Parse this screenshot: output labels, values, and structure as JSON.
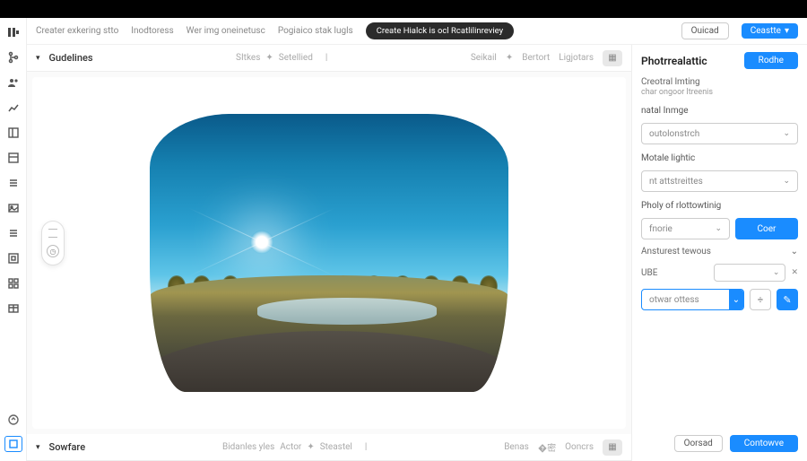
{
  "topbar": {
    "tabs": [
      "Creater exkering stto",
      "Inodtoress",
      "Wer img oneinetusc",
      "Pogiaico stak lugls"
    ],
    "pill": "Create Hialck is ocl Rcatlilinreviey",
    "outline_btn": "Ouicad",
    "primary_btn": "Ceastte"
  },
  "section_guidelines": {
    "title": "Gudelines",
    "mid": [
      "SItkes",
      "Setellied"
    ],
    "right": [
      "Seikail",
      "Bertort",
      "Ligjotars"
    ]
  },
  "section_software": {
    "title": "Sowfare",
    "mid": [
      "Bidanles yles",
      "Actor",
      "Steastel"
    ],
    "right": [
      "Benas",
      "Ooncrs"
    ]
  },
  "panel": {
    "title": "Photrrealattic",
    "action": "Rodhe",
    "subtitle": "Creotral lmting",
    "subtitle2": "char ongoor ltreenis",
    "fields": {
      "natal": {
        "label": "natal Inmge",
        "value": "outolonstrch"
      },
      "motale": {
        "label": "Motale lightic",
        "value": "nt attstreittes"
      },
      "pholy": {
        "label": "Pholy of rlottowtinig",
        "value": "fnorie",
        "btn": "Coer"
      },
      "ansturest": {
        "label": "Ansturest tewous"
      },
      "ube": {
        "label": "UBE",
        "value": "otwar ottess"
      }
    },
    "footer": {
      "cancel": "Oorsad",
      "confirm": "Contowve"
    }
  }
}
